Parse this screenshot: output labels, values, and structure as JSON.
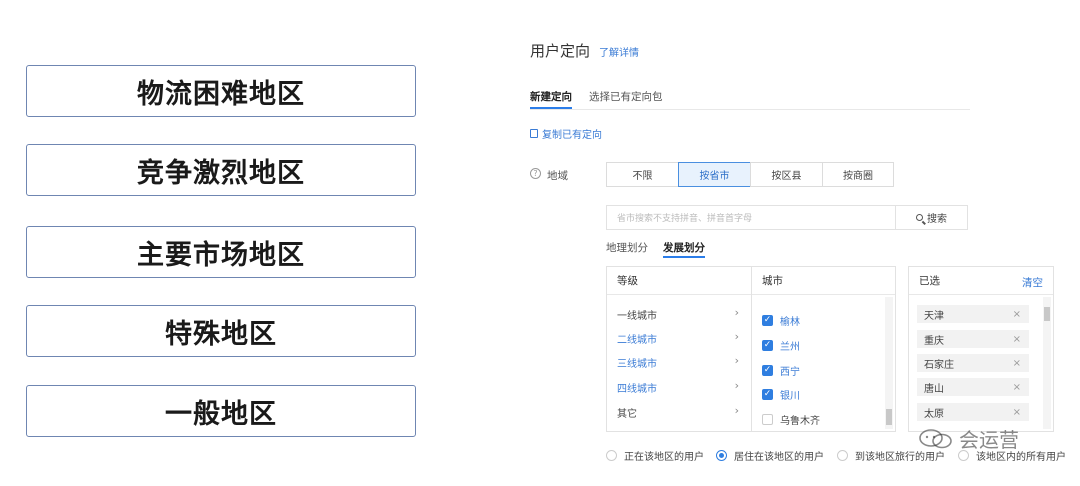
{
  "left_regions": [
    "物流困难地区",
    "竞争激烈地区",
    "主要市场地区",
    "特殊地区",
    "一般地区"
  ],
  "header": {
    "title": "用户定向",
    "learn_more": "了解详情"
  },
  "tabs": [
    {
      "label": "新建定向",
      "active": true
    },
    {
      "label": "选择已有定向包",
      "active": false
    }
  ],
  "copy_link": "复制已有定向",
  "region_field": {
    "label": "地域",
    "options": [
      {
        "label": "不限",
        "active": false
      },
      {
        "label": "按省市",
        "active": true
      },
      {
        "label": "按区县",
        "active": false
      },
      {
        "label": "按商圈",
        "active": false
      }
    ]
  },
  "search": {
    "placeholder": "省市搜索不支持拼音、拼音首字母",
    "button": "搜索"
  },
  "subtabs": [
    {
      "label": "地理划分",
      "active": false
    },
    {
      "label": "发展划分",
      "active": true
    }
  ],
  "levels_panel": {
    "header": "等级",
    "items": [
      {
        "label": "一线城市",
        "blue": false
      },
      {
        "label": "二线城市",
        "blue": true
      },
      {
        "label": "三线城市",
        "blue": true
      },
      {
        "label": "四线城市",
        "blue": true
      },
      {
        "label": "其它",
        "blue": false
      }
    ]
  },
  "cities_panel": {
    "header": "城市",
    "items": [
      {
        "label": "榆林",
        "checked": true
      },
      {
        "label": "兰州",
        "checked": true
      },
      {
        "label": "西宁",
        "checked": true
      },
      {
        "label": "银川",
        "checked": true
      },
      {
        "label": "乌鲁木齐",
        "checked": false
      }
    ]
  },
  "selected_panel": {
    "header": "已选",
    "clear": "清空",
    "items": [
      "天津",
      "重庆",
      "石家庄",
      "唐山",
      "太原"
    ]
  },
  "radios": [
    {
      "label": "正在该地区的用户",
      "checked": false
    },
    {
      "label": "居住在该地区的用户",
      "checked": true
    },
    {
      "label": "到该地区旅行的用户",
      "checked": false
    },
    {
      "label": "该地区内的所有用户",
      "checked": false
    }
  ],
  "watermark": "会运营",
  "colors": {
    "accent": "#2f7ee0",
    "link": "#3a7bd5",
    "card_border": "#6f86b2"
  }
}
